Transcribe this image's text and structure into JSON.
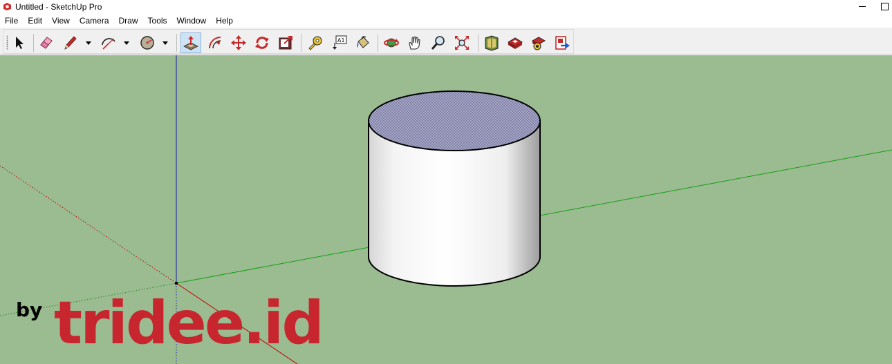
{
  "window": {
    "title": "Untitled - SketchUp Pro",
    "icon": "sketchup-logo-icon"
  },
  "menu": {
    "items": [
      "File",
      "Edit",
      "View",
      "Camera",
      "Draw",
      "Tools",
      "Window",
      "Help"
    ]
  },
  "toolbar": {
    "tools": [
      {
        "name": "select-tool",
        "icon": "arrow-cursor-icon"
      },
      {
        "name": "eraser-tool",
        "icon": "eraser-icon"
      },
      {
        "name": "line-tool",
        "icon": "pencil-icon",
        "dropdown": true
      },
      {
        "name": "arc-tool",
        "icon": "arc-icon",
        "dropdown": true
      },
      {
        "name": "shapes-tool",
        "icon": "circle-icon",
        "dropdown": true
      },
      {
        "name": "push-pull-tool",
        "icon": "push-pull-icon",
        "active": true
      },
      {
        "name": "offset-tool",
        "icon": "offset-icon"
      },
      {
        "name": "move-tool",
        "icon": "move-arrows-icon"
      },
      {
        "name": "rotate-tool",
        "icon": "rotate-icon"
      },
      {
        "name": "scale-tool",
        "icon": "scale-icon"
      },
      {
        "name": "tape-measure-tool",
        "icon": "tape-measure-icon"
      },
      {
        "name": "text-tool",
        "icon": "text-label-icon",
        "label": "A1"
      },
      {
        "name": "paint-bucket-tool",
        "icon": "paint-bucket-icon"
      },
      {
        "name": "orbit-tool",
        "icon": "orbit-icon"
      },
      {
        "name": "pan-tool",
        "icon": "hand-icon"
      },
      {
        "name": "zoom-tool",
        "icon": "magnifier-icon"
      },
      {
        "name": "zoom-extents-tool",
        "icon": "zoom-extents-icon"
      },
      {
        "name": "3d-warehouse-tool",
        "icon": "warehouse-icon"
      },
      {
        "name": "extension-warehouse-tool",
        "icon": "extension-warehouse-icon"
      },
      {
        "name": "sketchup-share-tool",
        "icon": "share-model-icon"
      },
      {
        "name": "send-to-layout-tool",
        "icon": "send-to-layout-icon"
      }
    ]
  },
  "colors": {
    "viewport_bg": "#9bbb91",
    "axis_red": "#c00000",
    "axis_green": "#1aa31a",
    "axis_blue": "#1a1aa8",
    "active_tool": "#cde2f4",
    "brand_red": "#c8262f"
  },
  "watermark": {
    "by": "by",
    "brand": "tridee.id"
  }
}
